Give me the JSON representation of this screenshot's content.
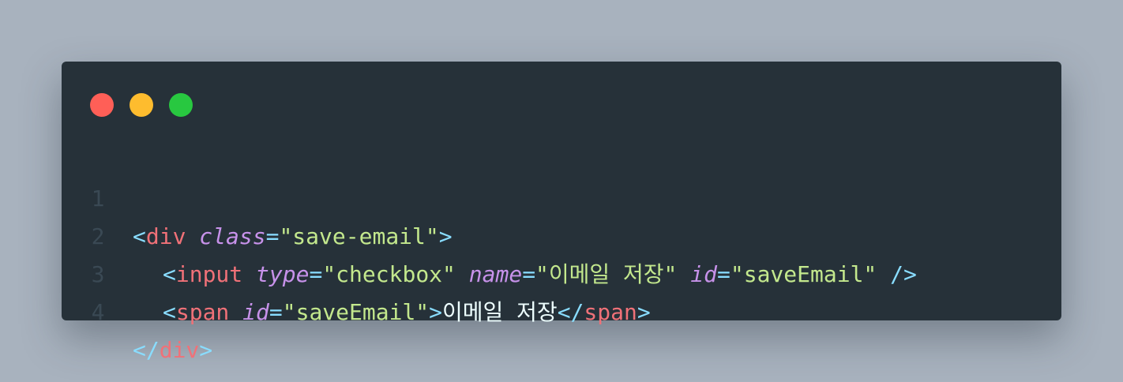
{
  "window": {
    "controls": [
      {
        "name": "close",
        "color": "#ff5f57"
      },
      {
        "name": "minimize",
        "color": "#febc2e"
      },
      {
        "name": "maximize",
        "color": "#28c840"
      }
    ]
  },
  "code": {
    "lines": [
      {
        "number": "1",
        "tokens": {
          "open": "<",
          "tag": "div",
          "attr1": "class",
          "eq1": "=",
          "val1": "\"save-email\"",
          "close": ">"
        }
      },
      {
        "number": "2",
        "tokens": {
          "open": "<",
          "tag": "input",
          "attr1": "type",
          "eq1": "=",
          "val1": "\"checkbox\"",
          "attr2": "name",
          "eq2": "=",
          "val2": "\"이메일 저장\"",
          "attr3": "id",
          "eq3": "=",
          "val3": "\"saveEmail\"",
          "close": "/>"
        }
      },
      {
        "number": "3",
        "tokens": {
          "open": "<",
          "tag": "span",
          "attr1": "id",
          "eq1": "=",
          "val1": "\"saveEmail\"",
          "close": ">",
          "text": "이메일 저장",
          "end_open": "</",
          "end_tag": "span",
          "end_close": ">"
        }
      },
      {
        "number": "4",
        "tokens": {
          "open": "</",
          "tag": "div",
          "close": ">"
        }
      }
    ]
  }
}
